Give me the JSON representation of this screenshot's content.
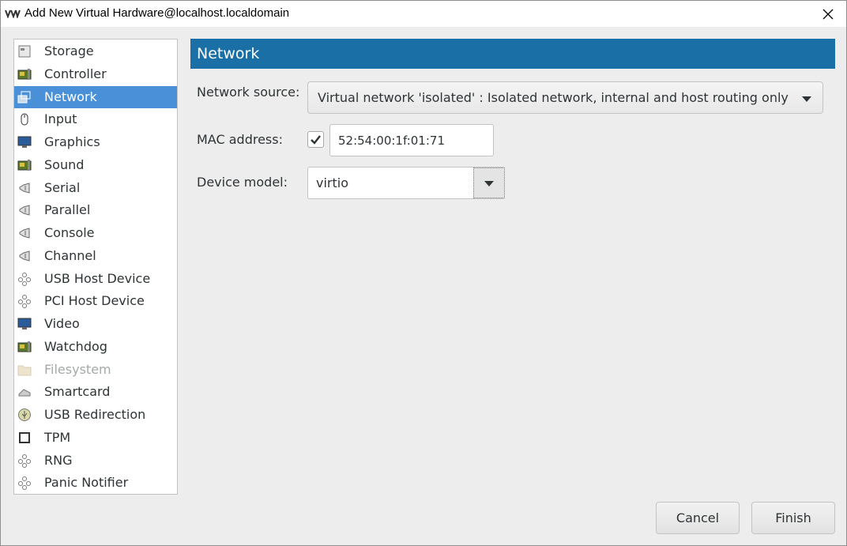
{
  "window": {
    "title": "Add New Virtual Hardware@localhost.localdomain"
  },
  "sidebar": {
    "selected": "Network",
    "items": [
      {
        "label": "Storage",
        "icon": "storage-icon"
      },
      {
        "label": "Controller",
        "icon": "controller-icon"
      },
      {
        "label": "Network",
        "icon": "network-icon"
      },
      {
        "label": "Input",
        "icon": "mouse-icon"
      },
      {
        "label": "Graphics",
        "icon": "monitor-icon"
      },
      {
        "label": "Sound",
        "icon": "sound-card-icon"
      },
      {
        "label": "Serial",
        "icon": "port-icon"
      },
      {
        "label": "Parallel",
        "icon": "port-icon"
      },
      {
        "label": "Console",
        "icon": "port-icon"
      },
      {
        "label": "Channel",
        "icon": "port-icon"
      },
      {
        "label": "USB Host Device",
        "icon": "device-icon"
      },
      {
        "label": "PCI Host Device",
        "icon": "device-icon"
      },
      {
        "label": "Video",
        "icon": "monitor-icon"
      },
      {
        "label": "Watchdog",
        "icon": "watchdog-card-icon"
      },
      {
        "label": "Filesystem",
        "icon": "folder-icon",
        "disabled": true
      },
      {
        "label": "Smartcard",
        "icon": "smartcard-icon"
      },
      {
        "label": "USB Redirection",
        "icon": "usb-icon"
      },
      {
        "label": "TPM",
        "icon": "chip-icon"
      },
      {
        "label": "RNG",
        "icon": "device-icon"
      },
      {
        "label": "Panic Notifier",
        "icon": "device-icon"
      }
    ]
  },
  "content": {
    "header": "Network",
    "network_source_label": "Network source:",
    "network_source_value": "Virtual network 'isolated' : Isolated network, internal and host routing only",
    "mac_label": "MAC address:",
    "mac_checked": true,
    "mac_value": "52:54:00:1f:01:71",
    "device_model_label": "Device model:",
    "device_model_value": "virtio"
  },
  "buttons": {
    "cancel": "Cancel",
    "finish": "Finish"
  },
  "colors": {
    "header_bg": "#1a6fa6",
    "selection_bg": "#4a90d9"
  }
}
